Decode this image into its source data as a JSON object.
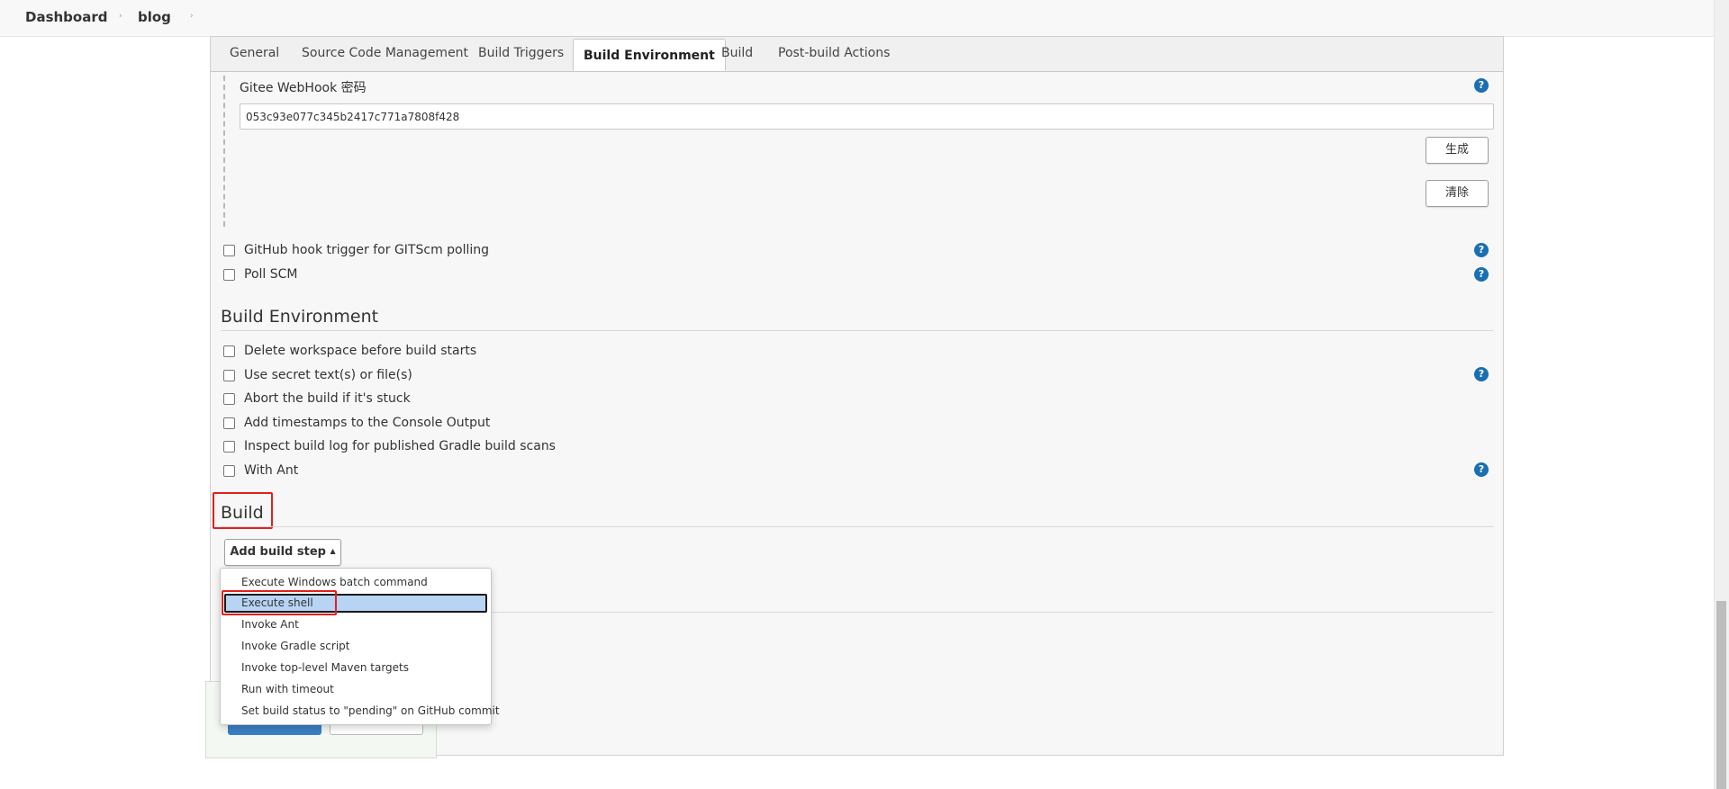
{
  "breadcrumb": {
    "items": [
      "Dashboard",
      "blog"
    ]
  },
  "tabs": [
    {
      "label": "General"
    },
    {
      "label": "Source Code Management"
    },
    {
      "label": "Build Triggers"
    },
    {
      "label": "Build Environment"
    },
    {
      "label": "Build"
    },
    {
      "label": "Post-build Actions"
    }
  ],
  "active_tab": "Build Environment",
  "webhook": {
    "label": "Gitee WebHook 密码",
    "value": "053c93e077c345b2417c771a7808f428",
    "generate_label": "生成",
    "clear_label": "清除"
  },
  "trigger_options": [
    {
      "label": "GitHub hook trigger for GITScm polling",
      "checked": false
    },
    {
      "label": "Poll SCM",
      "checked": false
    }
  ],
  "build_environment": {
    "title": "Build Environment",
    "options": [
      {
        "label": "Delete workspace before build starts",
        "checked": false
      },
      {
        "label": "Use secret text(s) or file(s)",
        "checked": false
      },
      {
        "label": "Abort the build if it's stuck",
        "checked": false
      },
      {
        "label": "Add timestamps to the Console Output",
        "checked": false
      },
      {
        "label": "Inspect build log for published Gradle build scans",
        "checked": false
      },
      {
        "label": "With Ant",
        "checked": false
      }
    ]
  },
  "build": {
    "title": "Build",
    "add_step_label": "Add build step",
    "add_step_arrow": "▲"
  },
  "dropdown": {
    "items": [
      "Execute Windows batch command",
      "Execute shell",
      "Invoke Ant",
      "Invoke Gradle script",
      "Invoke top-level Maven targets",
      "Run with timeout",
      "Set build status to \"pending\" on GitHub commit"
    ],
    "selected": "Execute shell"
  },
  "help_glyph": "?",
  "breadcrumb_separator": "›",
  "colors": {
    "accent": "#1a6fb0",
    "highlight_box": "#e02020",
    "selected_item_bg": "#b7d4f5"
  }
}
